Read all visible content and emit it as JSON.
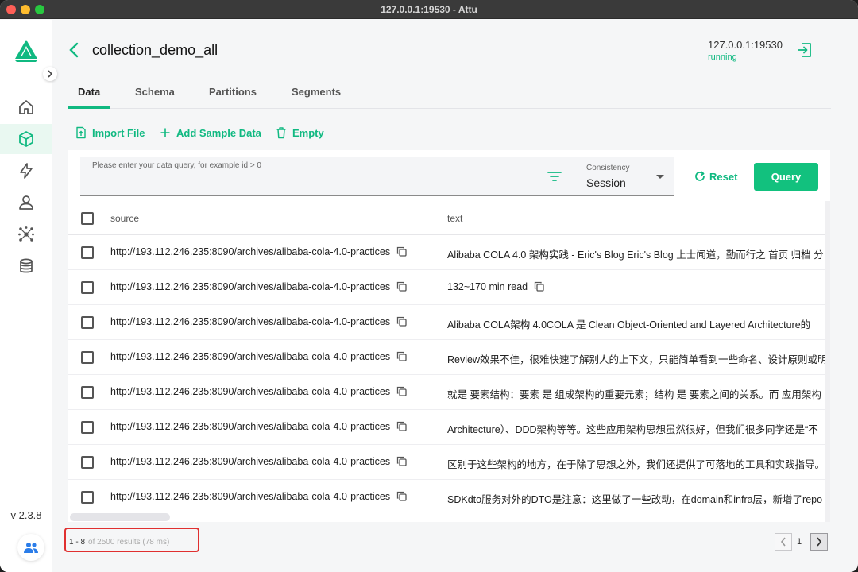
{
  "window": {
    "title": "127.0.0.1:19530 - Attu"
  },
  "sidebar": {
    "items": [
      {
        "icon": "home-icon"
      },
      {
        "icon": "cube-icon"
      },
      {
        "icon": "lightning-icon"
      },
      {
        "icon": "user-icon"
      },
      {
        "icon": "network-icon"
      },
      {
        "icon": "database-icon"
      }
    ],
    "active_index": 1,
    "version": "v 2.3.8"
  },
  "header": {
    "title": "collection_demo_all",
    "server": "127.0.0.1:19530",
    "status": "running"
  },
  "tabs": [
    {
      "label": "Data"
    },
    {
      "label": "Schema"
    },
    {
      "label": "Partitions"
    },
    {
      "label": "Segments"
    }
  ],
  "toolbar": {
    "import_label": "Import File",
    "add_sample_label": "Add Sample Data",
    "empty_label": "Empty"
  },
  "query": {
    "placeholder": "Please enter your data query, for example id > 0",
    "consistency_label": "Consistency",
    "consistency_value": "Session",
    "reset_label": "Reset",
    "query_label": "Query"
  },
  "table": {
    "columns": [
      "source",
      "text"
    ],
    "rows": [
      {
        "source": "http://193.112.246.235:8090/archives/alibaba-cola-4.0-practices",
        "text": "Alibaba COLA 4.0 架构实践 - Eric's Blog Eric's Blog 上士闻道，勤而行之 首页 归档 分"
      },
      {
        "source": "http://193.112.246.235:8090/archives/alibaba-cola-4.0-practices",
        "text": "132~170 min read"
      },
      {
        "source": "http://193.112.246.235:8090/archives/alibaba-cola-4.0-practices",
        "text": "Alibaba COLA架构 4.0COLA 是 Clean Object-Oriented and Layered Architecture的"
      },
      {
        "source": "http://193.112.246.235:8090/archives/alibaba-cola-4.0-practices",
        "text": "Review效果不佳，很难快速了解别人的上下文，只能简单看到一些命名、设计原则或明"
      },
      {
        "source": "http://193.112.246.235:8090/archives/alibaba-cola-4.0-practices",
        "text": "就是 要素结构：要素 是 组成架构的重要元素；结构 是 要素之间的关系。而 应用架构"
      },
      {
        "source": "http://193.112.246.235:8090/archives/alibaba-cola-4.0-practices",
        "text": "Architecture）、DDD架构等等。这些应用架构思想虽然很好，但我们很多同学还是“不"
      },
      {
        "source": "http://193.112.246.235:8090/archives/alibaba-cola-4.0-practices",
        "text": "区别于这些架构的地方，在于除了思想之外，我们还提供了可落地的工具和实践指导。"
      },
      {
        "source": "http://193.112.246.235:8090/archives/alibaba-cola-4.0-practices",
        "text": "SDKdto服务对外的DTO是注意：这里做了一些改动，在domain和infra层，新增了repo"
      }
    ]
  },
  "pagination": {
    "range": "1 - 8",
    "summary": "of 2500 results (78 ms)",
    "current_page": "1"
  },
  "colors": {
    "accent": "#10b981",
    "highlight": "#e03030"
  }
}
